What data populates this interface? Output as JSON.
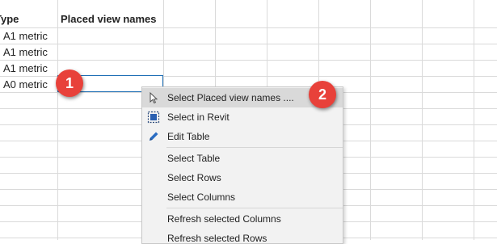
{
  "sheet": {
    "header": {
      "col_a": "Type",
      "col_b": "Placed view names"
    },
    "rows": [
      {
        "type": "A1 metric"
      },
      {
        "type": "A1 metric"
      },
      {
        "type": "A1 metric"
      },
      {
        "type": "A0 metric"
      }
    ]
  },
  "badges": {
    "first": "1",
    "second": "2"
  },
  "menu": {
    "select_placed": "Select Placed view names ....",
    "select_in_revit": "Select in Revit",
    "edit_table": "Edit Table",
    "select_table": "Select Table",
    "select_rows": "Select Rows",
    "select_columns": "Select Columns",
    "refresh_columns": "Refresh selected Columns",
    "refresh_rows": "Refresh selected Rows"
  },
  "colors": {
    "badge": "#e8413a",
    "selection": "#1f6fb5",
    "edit_icon": "#2a6cc2"
  }
}
